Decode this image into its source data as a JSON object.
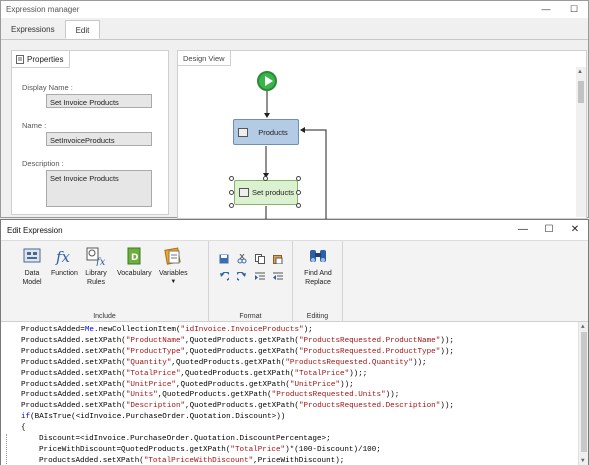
{
  "back_window": {
    "title": "Expression manager",
    "tabs": [
      "Expressions",
      "Edit"
    ],
    "properties": {
      "tab_label": "Properties",
      "display_name_label": "Display Name :",
      "display_name_value": "Set Invoice Products",
      "name_label": "Name :",
      "name_value": "SetInvoiceProducts",
      "description_label": "Description :",
      "description_value": "Set Invoice Products"
    },
    "design_view": {
      "tab_label": "Design View",
      "node_products": "Products",
      "node_set_products": "Set products"
    }
  },
  "dialog": {
    "title": "Edit Expression",
    "ribbon": {
      "include": {
        "title": "Include",
        "buttons": [
          {
            "label": "Data Model",
            "icon": "data-model-icon"
          },
          {
            "label": "Function",
            "icon": "function-icon"
          },
          {
            "label": "Library Rules",
            "icon": "library-rules-icon"
          },
          {
            "label": "Vocabulary",
            "icon": "vocabulary-icon"
          },
          {
            "label": "Variables",
            "icon": "variables-icon"
          }
        ]
      },
      "format": {
        "title": "Format"
      },
      "editing": {
        "title": "Editing",
        "find_replace": "Find And Replace"
      }
    },
    "code": [
      "ProductsAdded=Me.newCollectionItem(\"idInvoice.InvoiceProducts\");",
      "ProductsAdded.setXPath(\"ProductName\",QuotedProducts.getXPath(\"ProductsRequested.ProductName\"));",
      "ProductsAdded.setXPath(\"ProductType\",QuotedProducts.getXPath(\"ProductsRequested.ProductType\"));",
      "ProductsAdded.setXPath(\"Quantity\",QuotedProducts.getXPath(\"ProductsRequested.Quantity\"));",
      "ProductsAdded.setXPath(\"TotalPrice\",QuotedProducts.getXPath(\"TotalPrice\"));;",
      "ProductsAdded.setXPath(\"UnitPrice\",QuotedProducts.getXPath(\"UnitPrice\"));",
      "ProductsAdded.setXPath(\"Units\",QuotedProducts.getXPath(\"ProductsRequested.Units\"));",
      "ProductsAdded.setXPath(\"Description\",QuotedProducts.getXPath(\"ProductsRequested.Description\"));",
      "if(BAIsTrue(<idInvoice.PurchaseOrder.Quotation.Discount>))",
      "{",
      "Discount=<idInvoice.PurchaseOrder.Quotation.DiscountPercentage>;",
      "PriceWithDiscount=QuotedProducts.getXPath(\"TotalPrice\")*(100-Discount)/100;",
      "ProductsAdded.setXPath(\"TotalPriceWithDiscount\",PriceWithDiscount);",
      "}"
    ]
  },
  "colors": {
    "keyword": "#0000ff",
    "string": "#a31515",
    "start_node": "#3ab54a",
    "products_node": "#b3cbe4",
    "set_products_node": "#dbf1cf"
  }
}
